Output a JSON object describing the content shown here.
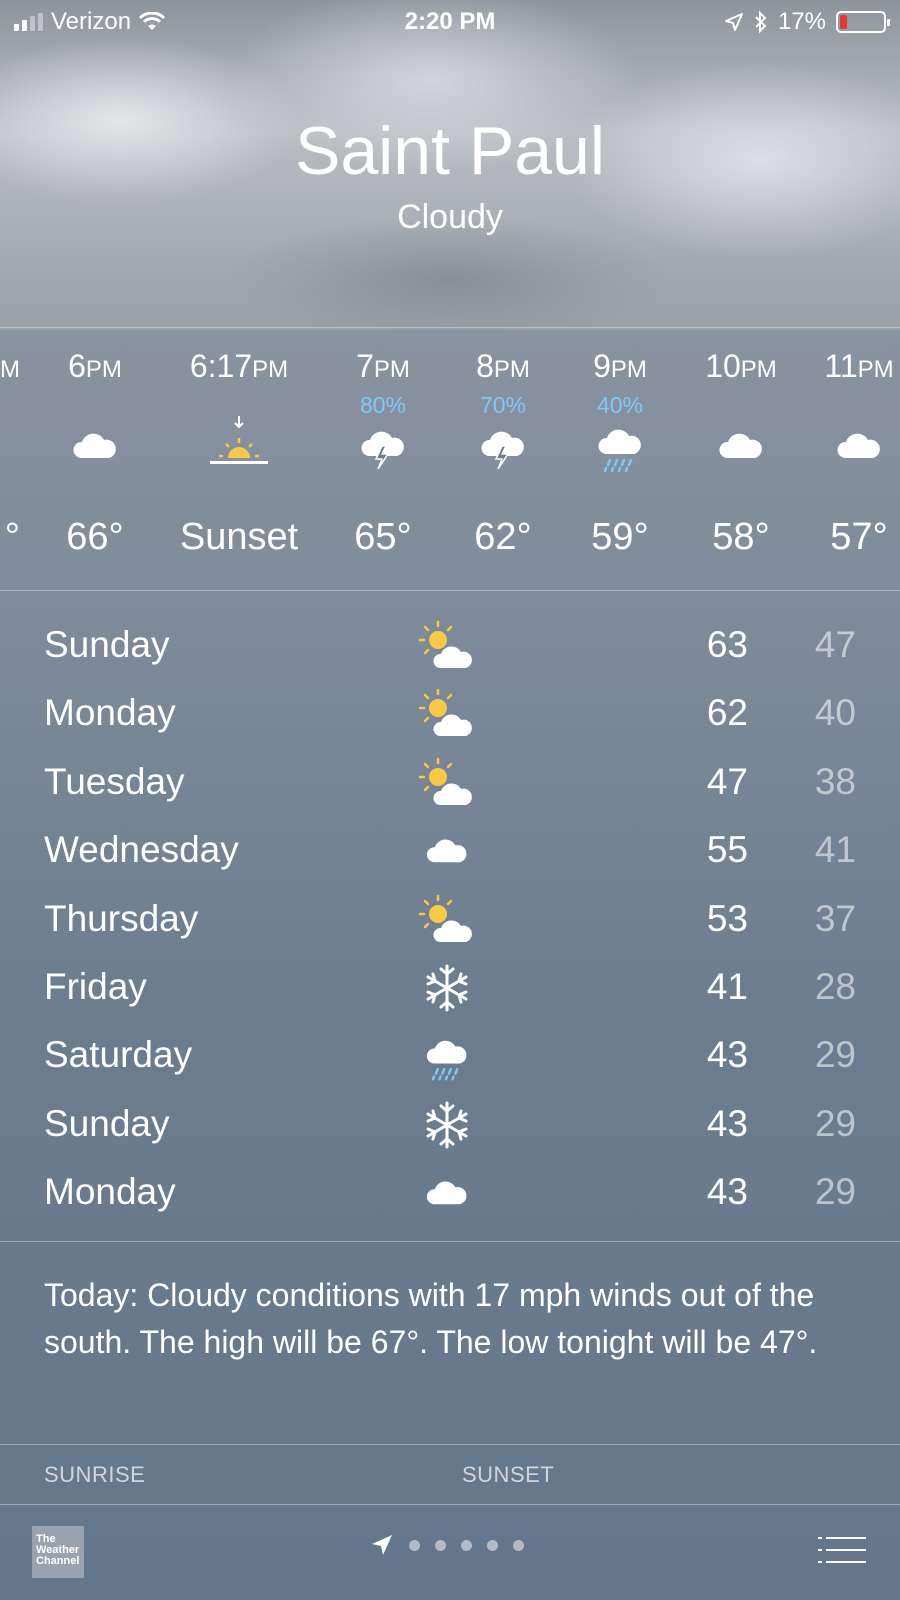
{
  "status_bar": {
    "carrier": "Verizon",
    "time": "2:20 PM",
    "battery": "17%"
  },
  "location": {
    "city": "Saint Paul",
    "condition": "Cloudy"
  },
  "hourly": [
    {
      "time": "6",
      "suffix": "PM",
      "pop": "",
      "icon": "cloud-icon",
      "temp": "66°"
    },
    {
      "time": "6:17",
      "suffix": "PM",
      "pop": "",
      "icon": "sunset-icon",
      "temp": "Sunset"
    },
    {
      "time": "7",
      "suffix": "PM",
      "pop": "80%",
      "icon": "thunderstorm-icon",
      "temp": "65°"
    },
    {
      "time": "8",
      "suffix": "PM",
      "pop": "70%",
      "icon": "thunderstorm-icon",
      "temp": "62°"
    },
    {
      "time": "9",
      "suffix": "PM",
      "pop": "40%",
      "icon": "rain-icon",
      "temp": "59°"
    },
    {
      "time": "10",
      "suffix": "PM",
      "pop": "",
      "icon": "cloud-icon",
      "temp": "58°"
    },
    {
      "time": "11",
      "suffix": "PM",
      "pop": "",
      "icon": "cloud-icon",
      "temp": "57°"
    }
  ],
  "daily": [
    {
      "day": "Sunday",
      "icon": "partly-cloudy-icon",
      "high": "63",
      "low": "47"
    },
    {
      "day": "Monday",
      "icon": "partly-cloudy-icon",
      "high": "62",
      "low": "40"
    },
    {
      "day": "Tuesday",
      "icon": "partly-cloudy-icon",
      "high": "47",
      "low": "38"
    },
    {
      "day": "Wednesday",
      "icon": "cloud-icon",
      "high": "55",
      "low": "41"
    },
    {
      "day": "Thursday",
      "icon": "partly-cloudy-icon",
      "high": "53",
      "low": "37"
    },
    {
      "day": "Friday",
      "icon": "snowflake-icon",
      "high": "41",
      "low": "28"
    },
    {
      "day": "Saturday",
      "icon": "rain-icon",
      "high": "43",
      "low": "29"
    },
    {
      "day": "Sunday",
      "icon": "snowflake-icon",
      "high": "43",
      "low": "29"
    },
    {
      "day": "Monday",
      "icon": "cloud-icon",
      "high": "43",
      "low": "29"
    }
  ],
  "summary": "Today: Cloudy conditions with 17 mph winds out of the south. The high will be 67°. The low tonight will be 47°.",
  "details": {
    "sunrise_label": "SUNRISE",
    "sunset_label": "SUNSET"
  },
  "footer": {
    "logo_text": "The Weather Channel",
    "page_count": 5
  },
  "colors": {
    "precip": "#7ec8f6",
    "sun": "#f7c948",
    "battery_low": "#e53935"
  }
}
